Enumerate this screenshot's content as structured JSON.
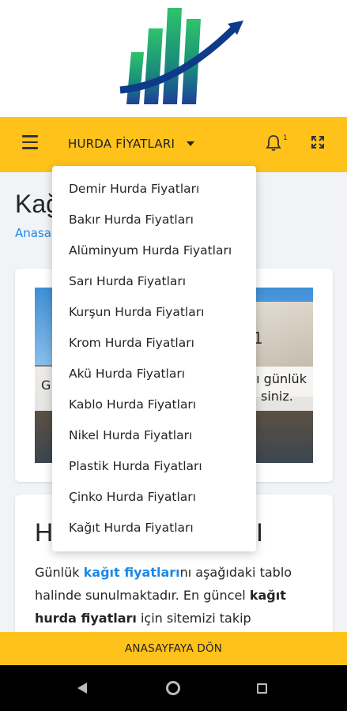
{
  "header": {
    "nav_title": "HURDA FİYATLARI",
    "notification_count": "1"
  },
  "page": {
    "title": "Kağ",
    "breadcrumb": "Anasa"
  },
  "banner": {
    "text_left": "G",
    "text_right_1": "nı günlük",
    "text_right_2": "siniz.",
    "number": "1"
  },
  "article": {
    "heading_start": "H",
    "heading_end": "I",
    "para_1": "Günlük ",
    "para_link": "kağıt fiyatları",
    "para_2": "nı aşağıdaki tablo halinde sunulmaktadır. En güncel ",
    "para_bold_1": "kağıt hurda fiyatları",
    "para_3": " için sitemizi takip"
  },
  "dropdown": {
    "items": [
      "Demir Hurda Fiyatları",
      "Bakır Hurda Fiyatları",
      "Alüminyum Hurda Fiyatları",
      "Sarı Hurda Fiyatları",
      "Kurşun Hurda Fiyatları",
      "Krom Hurda Fiyatları",
      "Akü Hurda Fiyatları",
      "Kablo Hurda Fiyatları",
      "Nikel Hurda Fiyatları",
      "Plastik Hurda Fiyatları",
      "Çinko Hurda Fiyatları",
      "Kağıt Hurda Fiyatları"
    ]
  },
  "footer": {
    "home_button": "ANASAYFAYA DÖN"
  },
  "colors": {
    "accent": "#ffc21b",
    "link": "#1e88e5"
  }
}
